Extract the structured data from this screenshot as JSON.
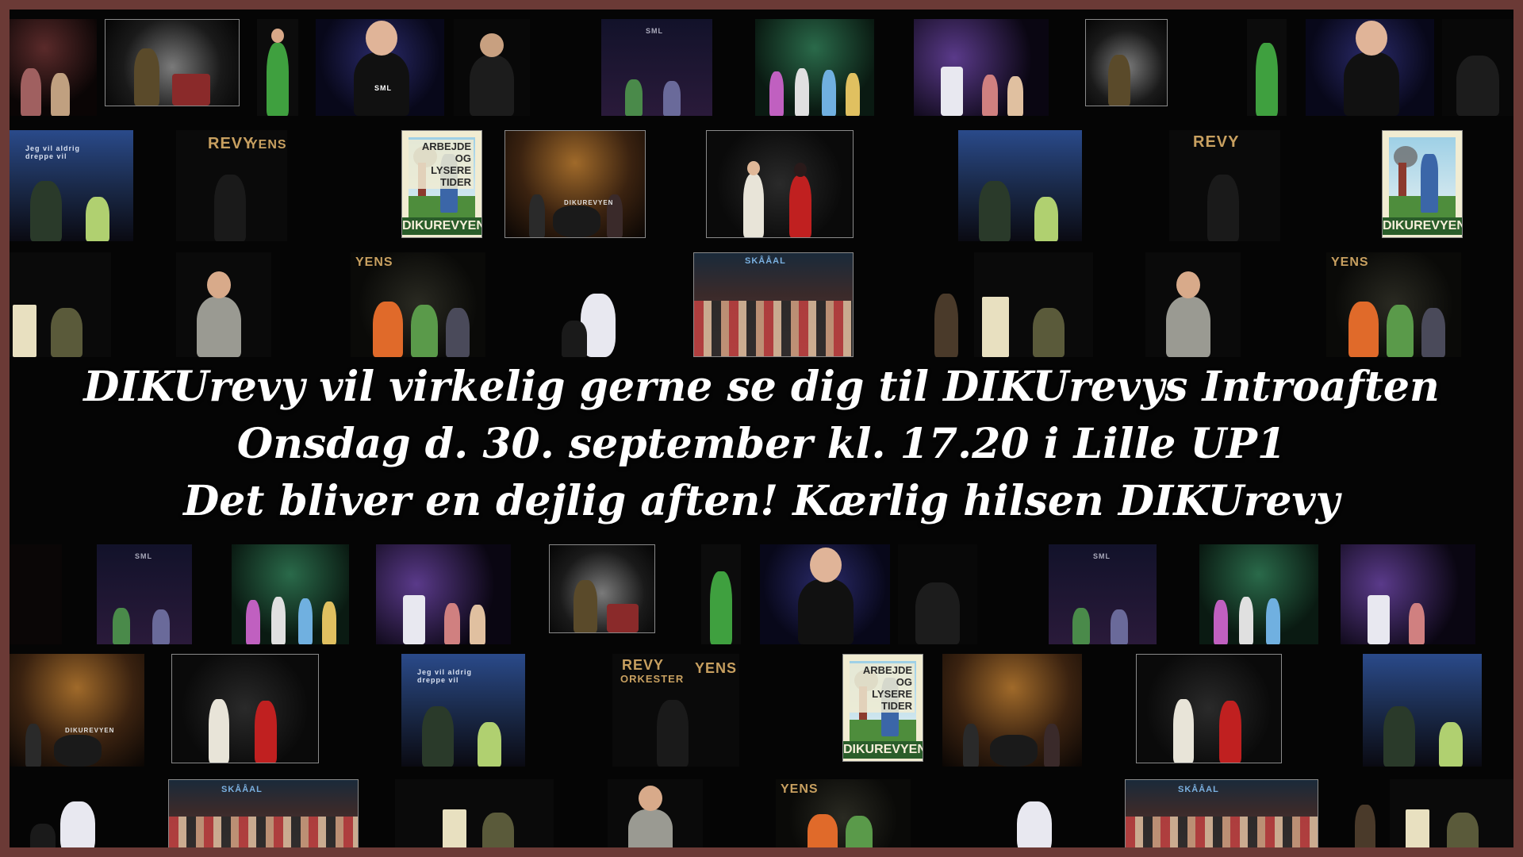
{
  "headline": {
    "line1": "DIKUrevy vil virkelig gerne se dig til DIKUrevys Introaften",
    "line2": "Onsdag d. 30. september kl. 17.20 i Lille UP1",
    "line3": "Det bliver en dejlig aften! Kærlig hilsen DIKUrevy"
  },
  "photo_signs": {
    "sml": "SML",
    "slide_text": "Jeg vil aldrig dreppe vil",
    "revy_band": "REVY",
    "orkester": "ORKESTER",
    "ens": "YENS",
    "skaal": "SKÅÅAL",
    "dikurevyen_stage": "DIKUREVYEN"
  },
  "poster_art": {
    "top_line1": "ARBEJDE OG",
    "top_line2": "LYSERE",
    "top_line3": "TIDER",
    "bottom": "DIKUREVYEN"
  },
  "colors": {
    "frame": "#6b3a36",
    "background": "#050505",
    "headline_text": "#ffffff"
  }
}
